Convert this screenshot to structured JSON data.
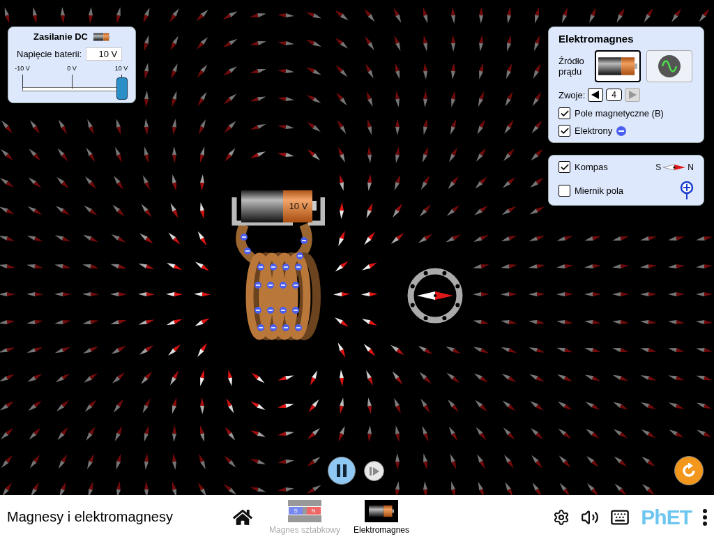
{
  "dc_panel": {
    "title": "Zasilanie DC",
    "voltage_label": "Napięcie baterii:",
    "voltage_value": "10 V",
    "ticks": [
      "-10 V",
      "0 V",
      "10 V"
    ],
    "slider": {
      "level": 1
    }
  },
  "electromagnet_panel": {
    "title": "Elektromagnes",
    "source_label": "Źródło prądu",
    "sources": [
      {
        "kind": "dc",
        "selected": true
      },
      {
        "kind": "ac",
        "selected": false
      }
    ],
    "loops_label": "Zwoje:",
    "loops_value": "4",
    "decrease": {
      "disabled": false
    },
    "increase": {
      "disabled": true
    },
    "checkboxes": [
      {
        "kind": "field",
        "label": "Pole magnetyczne (B)",
        "checked": true
      },
      {
        "kind": "electrons",
        "label": "Elektrony",
        "checked": true
      }
    ]
  },
  "tools_panel": {
    "items": [
      {
        "kind": "compass",
        "label": "Kompas",
        "checked": true,
        "legend_s": "S",
        "legend_n": "N"
      },
      {
        "kind": "field_meter",
        "label": "Miernik pola",
        "checked": false
      }
    ]
  },
  "battery_label": "10 V",
  "playback": {
    "playing": true
  },
  "nav": {
    "title": "Magnesy i elektromagnesy",
    "screens": [
      {
        "kind": "bar_magnet",
        "label": "Magnes sztabkowy",
        "selected": false,
        "icon_s": "S",
        "icon_n": "N"
      },
      {
        "kind": "electromagnet",
        "label": "Elektromagnes",
        "selected": true
      }
    ],
    "logo": "PhET"
  }
}
